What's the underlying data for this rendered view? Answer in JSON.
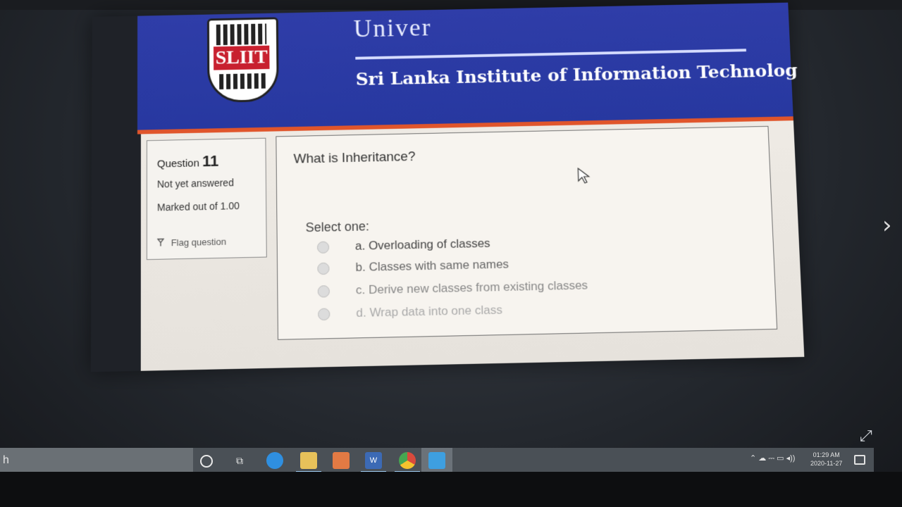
{
  "header": {
    "logo_text": "SLIIT",
    "university_top": "Univer",
    "university_name": "Sri Lanka Institute of Information Technolog"
  },
  "question_info": {
    "question_label": "Question",
    "question_number": "11",
    "status": "Not yet answered",
    "marks": "Marked out of 1.00",
    "flag_label": "Flag question"
  },
  "question": {
    "text": "What is Inheritance?",
    "select_prompt": "Select one:",
    "options": [
      {
        "label": "a. Overloading of classes"
      },
      {
        "label": "b. Classes with same names"
      },
      {
        "label": "c. Derive new classes from existing classes"
      },
      {
        "label": "d. Wrap data into one class"
      }
    ]
  },
  "taskbar": {
    "search_text": "h",
    "word_icon_text": "W",
    "time": "01:29 AM",
    "date": "2020-11-27"
  },
  "icons": {
    "next": "chevron-right-icon",
    "expand": "expand-icon",
    "flag": "flag-icon"
  }
}
